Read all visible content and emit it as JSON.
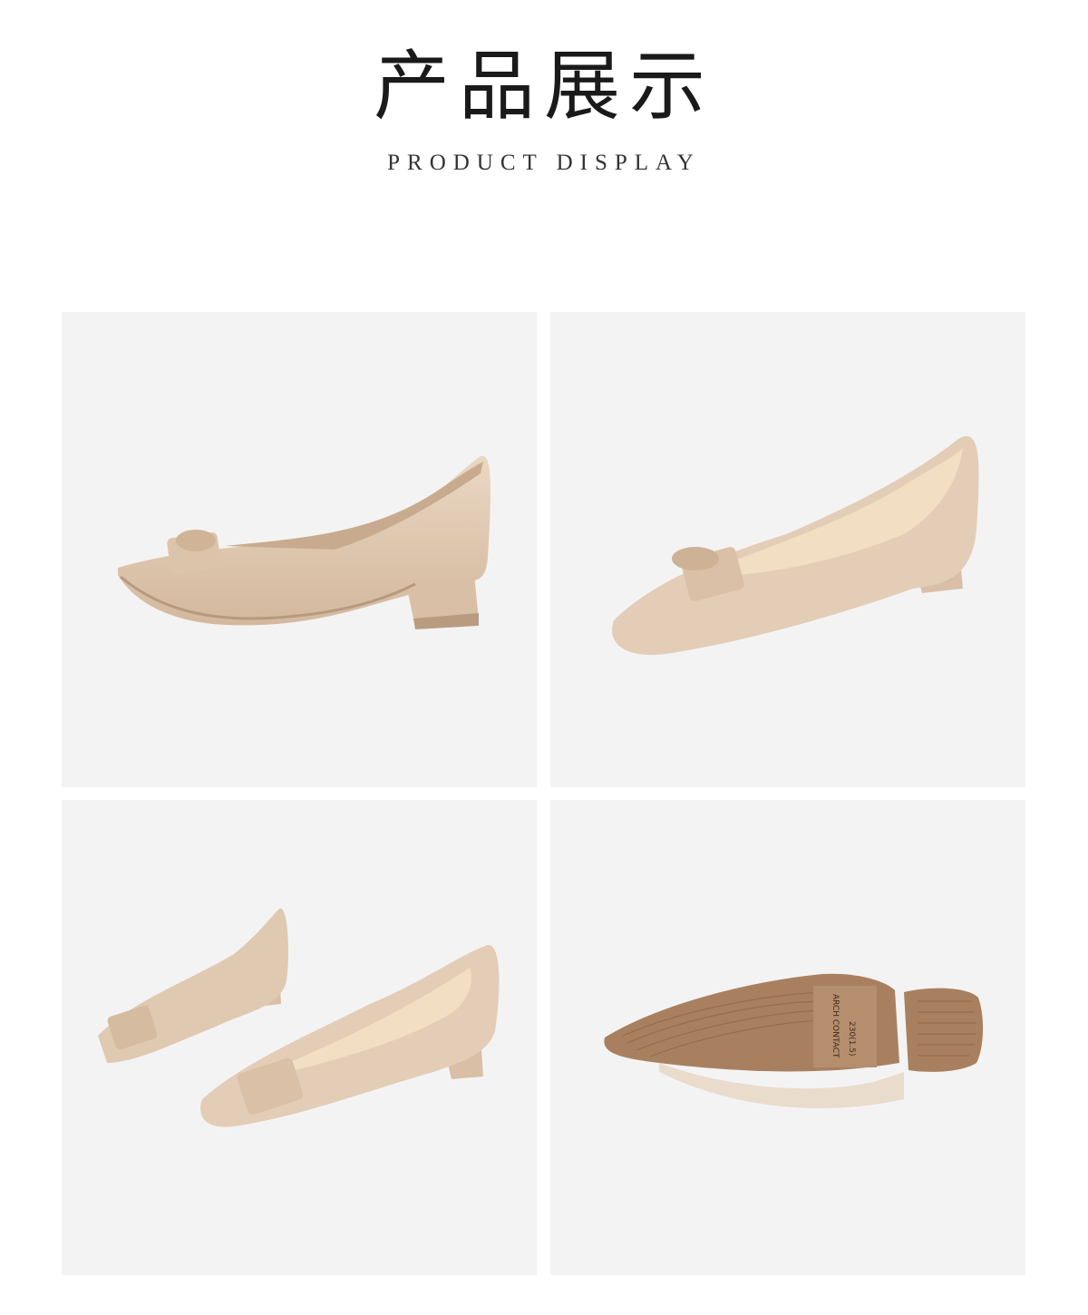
{
  "header": {
    "title": "产品展示",
    "subtitle": "PRODUCT DISPLAY"
  },
  "colors": {
    "leather": "#e1cbb4",
    "leather_shadow": "#c9ae94",
    "lining": "#f0dcbf",
    "sole": "#b08868",
    "panel_bg": "#f4f3f4"
  },
  "panels": [
    {
      "view": "side"
    },
    {
      "view": "three-quarter"
    },
    {
      "view": "pair"
    },
    {
      "view": "outsole",
      "sole_text": "ARCH CONTACT",
      "size_text": "230(1.5)"
    }
  ]
}
